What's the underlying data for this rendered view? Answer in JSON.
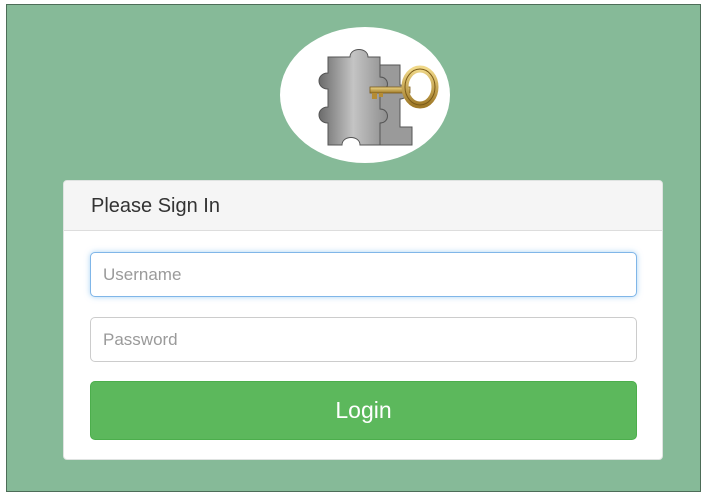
{
  "logo": {
    "icon": "puzzle-key-icon"
  },
  "login_panel": {
    "heading": "Please Sign In",
    "username_placeholder": "Username",
    "password_placeholder": "Password",
    "login_label": "Login"
  },
  "colors": {
    "background": "#86ba98",
    "button": "#5cb85c",
    "focus_ring": "#80b6e8"
  }
}
